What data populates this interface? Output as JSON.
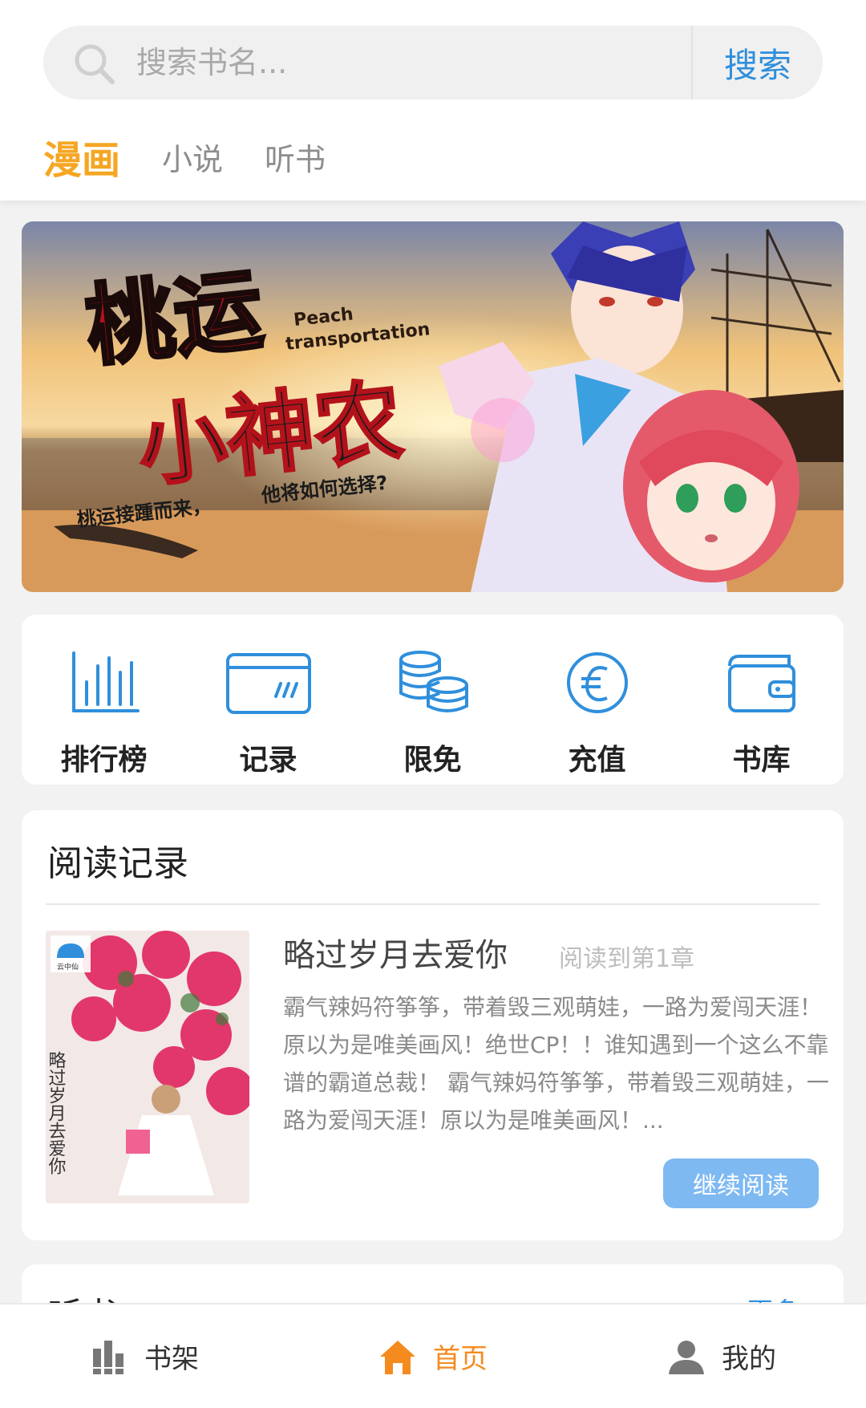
{
  "search": {
    "placeholder": "搜索书名...",
    "button_label": "搜索"
  },
  "tabs": [
    {
      "label": "漫画",
      "active": true
    },
    {
      "label": "小说",
      "active": false
    },
    {
      "label": "听书",
      "active": false
    }
  ],
  "banner": {
    "title_line1": "桃运",
    "title_line2": "小神农",
    "subtitle_en_1": "Peach",
    "subtitle_en_2": "transportation",
    "tagline_left": "桃运接踵而来，",
    "tagline_right": "他将如何选择?"
  },
  "categories": [
    {
      "label": "排行榜",
      "icon": "ranking-chart-icon"
    },
    {
      "label": "记录",
      "icon": "card-record-icon"
    },
    {
      "label": "限免",
      "icon": "coins-stack-icon"
    },
    {
      "label": "充值",
      "icon": "euro-coin-icon"
    },
    {
      "label": "书库",
      "icon": "wallet-icon"
    }
  ],
  "reading_record": {
    "section_title": "阅读记录",
    "book": {
      "title": "略过岁月去爱你",
      "progress": "阅读到第1章",
      "description": "霸气辣妈符筝筝，带着毁三观萌娃，一路为爱闯天涯！原以为是唯美画风！绝世CP！！谁知遇到一个这么不靠谱的霸道总裁！ 霸气辣妈符筝筝，带着毁三观萌娃，一路为爱闯天涯！原以为是唯美画风！...",
      "cover_text": "略过岁月去爱你",
      "cover_logo": "云中仙"
    },
    "continue_label": "继续阅读"
  },
  "next_section": {
    "title": "听书",
    "more": "更多"
  },
  "bottom_nav": [
    {
      "label": "书架",
      "icon": "bookshelf-icon",
      "active": false
    },
    {
      "label": "首页",
      "icon": "home-icon",
      "active": true
    },
    {
      "label": "我的",
      "icon": "user-icon",
      "active": false
    }
  ],
  "colors": {
    "accent_orange": "#f5a623",
    "primary_blue": "#2f8fdc",
    "button_blue": "#7eb9f2",
    "nav_active": "#f58a1f"
  }
}
